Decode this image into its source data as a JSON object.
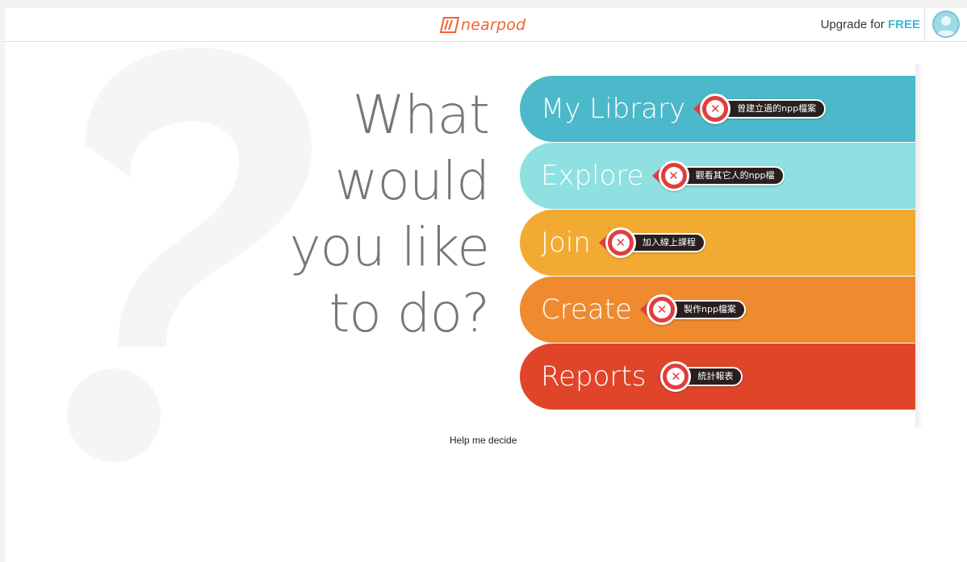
{
  "header": {
    "logo_text": "nearpod",
    "upgrade_prefix": "Upgrade for ",
    "upgrade_emphasis": "FREE"
  },
  "headline": [
    "What",
    "would",
    "you like",
    "to do?"
  ],
  "menu": [
    {
      "label": "My Library",
      "note": "曾建立過的npp檔案",
      "color": "#4bb9c9",
      "icon": "x-mark-icon"
    },
    {
      "label": "Explore",
      "note": "觀看其它人的npp檔",
      "color": "#8fe0e0",
      "icon": "x-mark-icon"
    },
    {
      "label": "Join",
      "note": "加入線上課程",
      "color": "#f2aa32",
      "icon": "x-mark-icon"
    },
    {
      "label": "Create",
      "note": "製作npp檔案",
      "color": "#ef8a2f",
      "icon": "x-mark-icon"
    },
    {
      "label": "Reports",
      "note": "統計報表",
      "color": "#e0452a",
      "icon": "x-mark-icon"
    }
  ],
  "help_link": "Help me decide",
  "colors": {
    "brand": "#f0642b",
    "accent": "#44b6d5",
    "annotation": "#e03e3e"
  }
}
